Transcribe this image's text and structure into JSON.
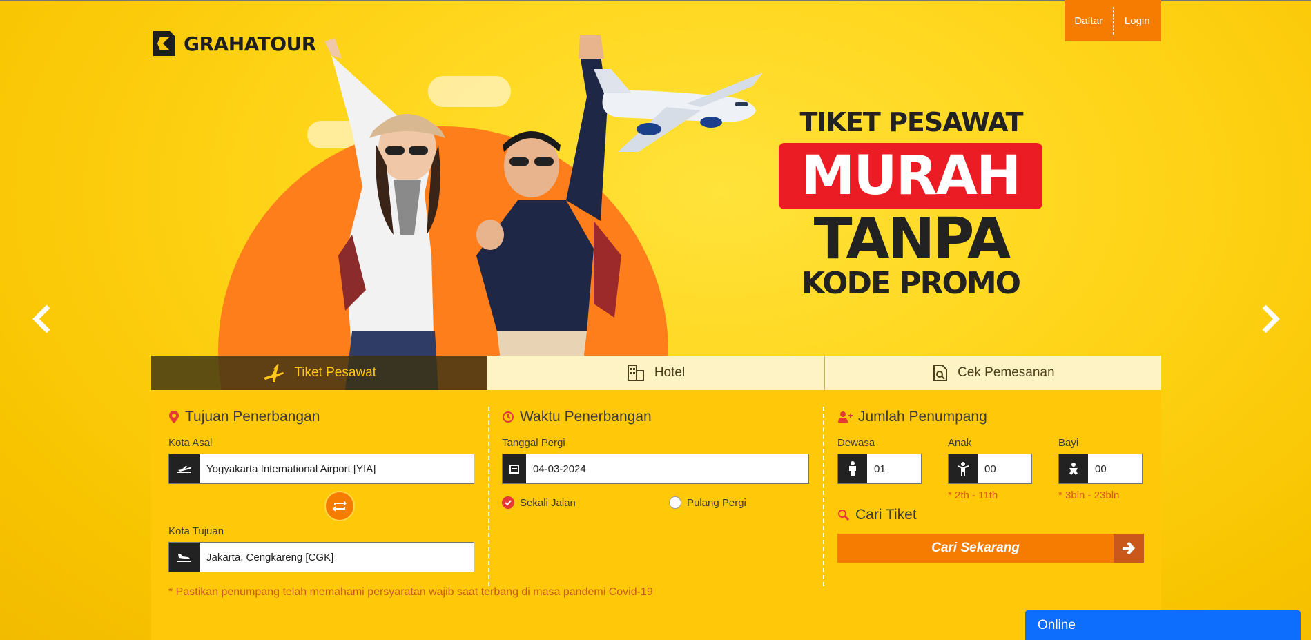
{
  "brand": {
    "name": "GRAHATOUR"
  },
  "auth": {
    "register": "Daftar",
    "login": "Login"
  },
  "banner": {
    "line1": "TIKET PESAWAT",
    "line2": "MURAH",
    "line3": "TANPA",
    "line4": "KODE PROMO"
  },
  "tabs": [
    {
      "label": "Tiket Pesawat",
      "icon": "airplanes-icon",
      "active": true
    },
    {
      "label": "Hotel",
      "icon": "building-icon",
      "active": false
    },
    {
      "label": "Cek Pemesanan",
      "icon": "document-search-icon",
      "active": false
    }
  ],
  "route": {
    "title": "Tujuan Penerbangan",
    "origin_label": "Kota Asal",
    "origin_value": "Yogyakarta International Airport [YIA]",
    "destination_label": "Kota Tujuan",
    "destination_value": "Jakarta, Cengkareng [CGK]"
  },
  "schedule": {
    "title": "Waktu Penerbangan",
    "date_label": "Tanggal Pergi",
    "date_value": "04-03-2024",
    "one_way": "Sekali Jalan",
    "round_trip": "Pulang Pergi",
    "selected": "one_way"
  },
  "passengers": {
    "title": "Jumlah Penumpang",
    "adult_label": "Dewasa",
    "adult_value": "01",
    "child_label": "Anak",
    "child_value": "00",
    "child_note": "* 2th - 11th",
    "infant_label": "Bayi",
    "infant_value": "00",
    "infant_note": "* 3bln - 23bln"
  },
  "search": {
    "title": "Cari Tiket",
    "button": "Cari Sekarang"
  },
  "notice": "* Pastikan penumpang telah memahami persyaratan wajib saat terbang di masa pandemi Covid-19",
  "chat": {
    "label": "Online"
  },
  "colors": {
    "brand_yellow": "#ffc90a",
    "brand_orange": "#f57c00",
    "accent_red": "#ec1c24",
    "chat_blue": "#0d6efd"
  }
}
